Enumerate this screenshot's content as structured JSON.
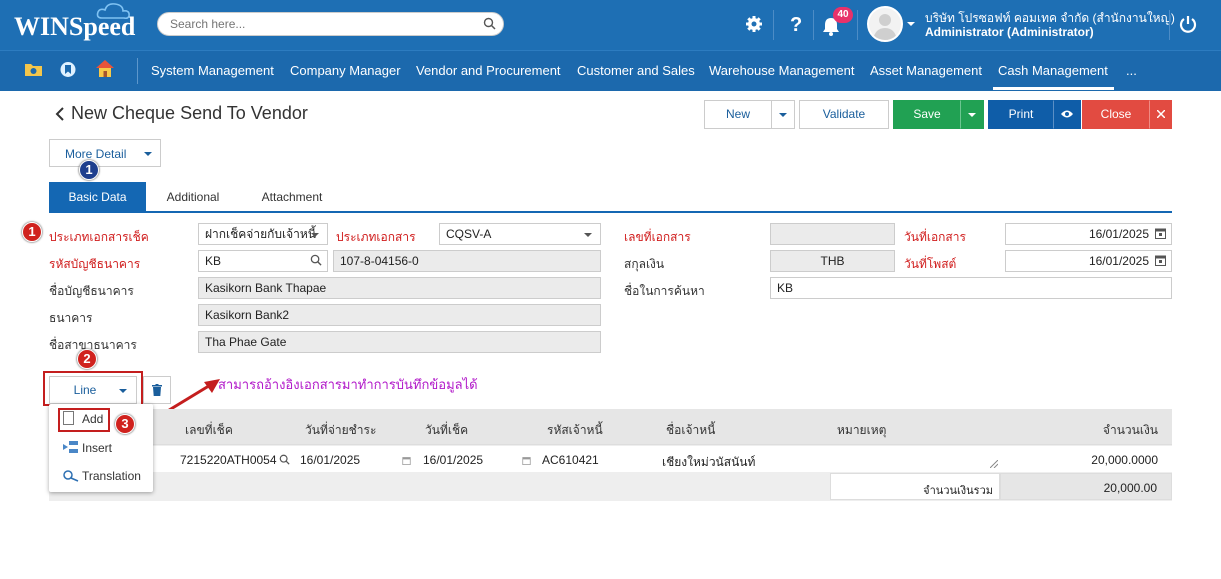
{
  "app": {
    "brand": "WINSpeed"
  },
  "search": {
    "placeholder": "Search here..."
  },
  "topbar": {
    "notification_count": "40",
    "company": "บริษัท โปรซอฟท์ คอมเทค จำกัด (สำนักงานใหญ่)",
    "user": "Administrator (Administrator)"
  },
  "nav": {
    "items": [
      "System Management",
      "Company Manager",
      "Vendor and Procurement",
      "Customer and Sales",
      "Warehouse Management",
      "Asset Management",
      "Cash Management",
      "..."
    ],
    "active": "Cash Management"
  },
  "page": {
    "title": "New Cheque Send To Vendor"
  },
  "toolbar": {
    "new": "New",
    "validate": "Validate",
    "save": "Save",
    "print": "Print",
    "close": "Close"
  },
  "more_detail": "More Detail",
  "tabs": [
    "Basic Data",
    "Additional",
    "Attachment"
  ],
  "form": {
    "cheque_doc_type_label": "ประเภทเอกสารเช็ค",
    "cheque_doc_type_value": "ฝากเช็คจ่ายกับเจ้าหนี้",
    "doc_type_label": "ประเภทเอกสาร",
    "doc_type_value": "CQSV-A",
    "doc_no_label": "เลขที่เอกสาร",
    "doc_no_value": "",
    "doc_date_label": "วันที่เอกสาร",
    "doc_date_value": "16/01/2025",
    "bank_account_code_label": "รหัสบัญชีธนาคาร",
    "bank_account_code_value": "KB",
    "bank_account_no": "107-8-04156-0",
    "currency_label": "สกุลเงิน",
    "currency_value": "THB",
    "post_date_label": "วันที่โพสต์",
    "post_date_value": "16/01/2025",
    "bank_account_name_label": "ชื่อบัญชีธนาคาร",
    "bank_account_name_value": "Kasikorn Bank Thapae",
    "search_name_label": "ชื่อในการค้นหา",
    "search_name_value": "KB",
    "bank_label": "ธนาคาร",
    "bank_value": "Kasikorn Bank2",
    "branch_label": "ชื่อสาขาธนาคาร",
    "branch_value": "Tha Phae Gate"
  },
  "annotations": {
    "step1": "1",
    "step2": "2",
    "step3": "3",
    "hint": "สามารถอ้างอิงเอกสารมาทำการบันทึกข้อมูลได้"
  },
  "line": {
    "button": "Line",
    "menu": [
      "Add",
      "Insert",
      "Translation"
    ]
  },
  "grid": {
    "headers": [
      "เลขที่เช็ค",
      "วันที่จ่ายชำระ",
      "วันที่เช็ค",
      "รหัสเจ้าหนี้",
      "ชื่อเจ้าหนี้",
      "หมายเหตุ",
      "จำนวนเงิน"
    ],
    "rows": [
      {
        "cheque_no": "7215220ATH0054",
        "pay_date": "16/01/2025",
        "cheque_date": "16/01/2025",
        "vendor_code": "AC610421",
        "vendor_name": "เชียงใหม่วนัสนันท์",
        "remark": "",
        "amount": "20,000.0000"
      }
    ],
    "total_label": "จำนวนเงินรวม",
    "total_value": "20,000.00"
  },
  "colors": {
    "topbar": "#1e6fb4",
    "tab_active": "#1467b3",
    "save": "#21a153",
    "print": "#0f5da8",
    "close": "#e24b41",
    "required": "#d01c1c",
    "hint": "#b117c9"
  },
  "icons": [
    "cloud-icon",
    "search-icon",
    "gear-icon",
    "help-icon",
    "bell-icon",
    "power-icon",
    "folder-icon",
    "bookmark-icon",
    "home-icon",
    "calendar-icon",
    "trash-icon",
    "eye-icon"
  ]
}
